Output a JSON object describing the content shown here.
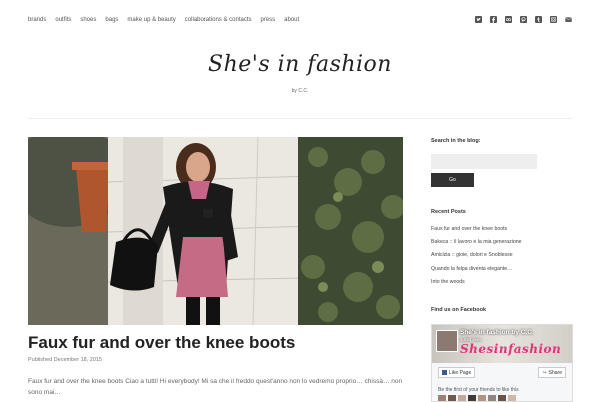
{
  "nav": {
    "items": [
      "brands",
      "outfits",
      "shoes",
      "bags",
      "make up & beauty",
      "collaborations & contacts",
      "press",
      "about"
    ],
    "social_icons": [
      "twitter-icon",
      "facebook-icon",
      "tripadvisor-icon",
      "pinterest-icon",
      "tumblr-icon",
      "instagram-icon",
      "email-icon"
    ]
  },
  "header": {
    "title": "She's in fashion",
    "byline": "by C.C."
  },
  "post": {
    "title": "Faux fur and over the knee boots",
    "date": "Published December 18, 2015",
    "excerpt": "Faux fur and over the knee boots Ciao a tutti! Hi everybody! Mi sa che il freddo quest'anno non lo vedremo proprio… chissà… non sono mai…"
  },
  "sidebar": {
    "search_heading": "Search in the blog:",
    "search_placeholder": "",
    "go_label": "Go",
    "recent_heading": "Recent Posts",
    "recent_posts": [
      "Faux fur and over the knee boots",
      "Bakeca :: il lavoro e la mia generazione",
      "Amicizia :: gioie, dolori e Snoblesse",
      "Quando la felpa diventa elegante…",
      "Into the woods"
    ],
    "facebook_heading": "Find us on Facebook",
    "facebook": {
      "page_name": "She's in fashion by C.C.",
      "likes": "1,054 likes",
      "cover_text": "Shesinfashion",
      "like_label": "Like Page",
      "share_label": "Share",
      "friends_text": "Be the first of your friends to like this"
    }
  },
  "colors": {
    "accent_pink": "#e0357a",
    "button_dark": "#333333",
    "facebook_blue": "#3b5998"
  }
}
